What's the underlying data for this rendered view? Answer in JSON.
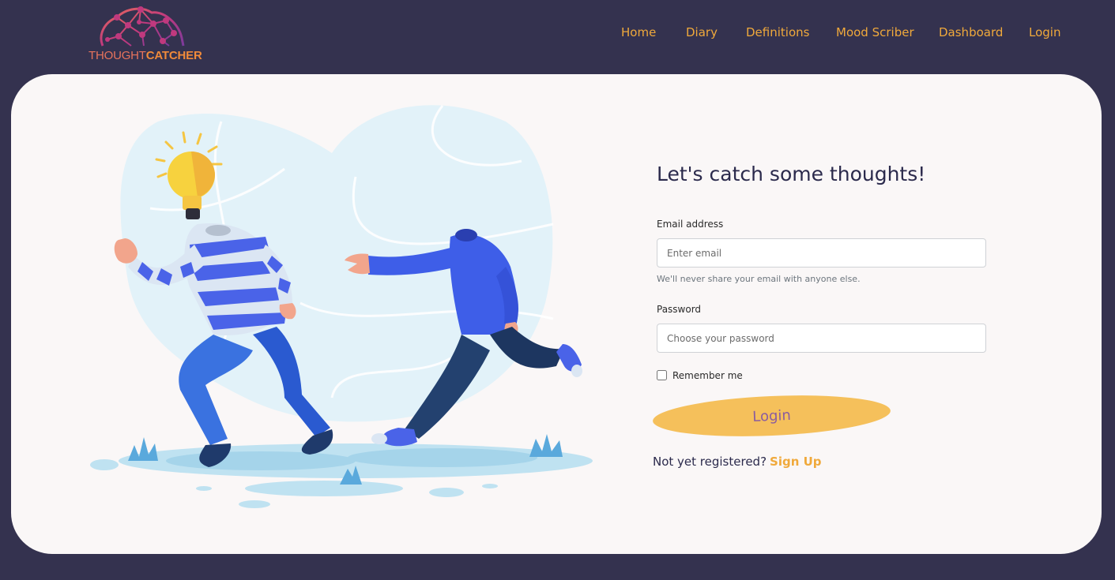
{
  "brand": {
    "logo_text_part1": "THOUGHT",
    "logo_text_part2": "CATCHER"
  },
  "nav": {
    "items": [
      {
        "label": "Home"
      },
      {
        "label": "Diary"
      },
      {
        "label": "Definitions"
      },
      {
        "label": "Mood Scriber"
      },
      {
        "label": "Dashboard"
      },
      {
        "label": "Login"
      }
    ]
  },
  "form": {
    "heading": "Let's catch some thoughts!",
    "email_label": "Email address",
    "email_placeholder": "Enter email",
    "email_help": "We'll never share your email with anyone else.",
    "password_label": "Password",
    "password_placeholder": "Choose your password",
    "remember_label": "Remember me",
    "remember_checked": false,
    "login_button": "Login",
    "signup_prompt": "Not yet registered?",
    "signup_link": "Sign Up"
  },
  "colors": {
    "background": "#34324f",
    "card": "#faf7f7",
    "accent": "#f0a93b",
    "button": "#f5c05b",
    "button_text": "#8a5ca0"
  }
}
